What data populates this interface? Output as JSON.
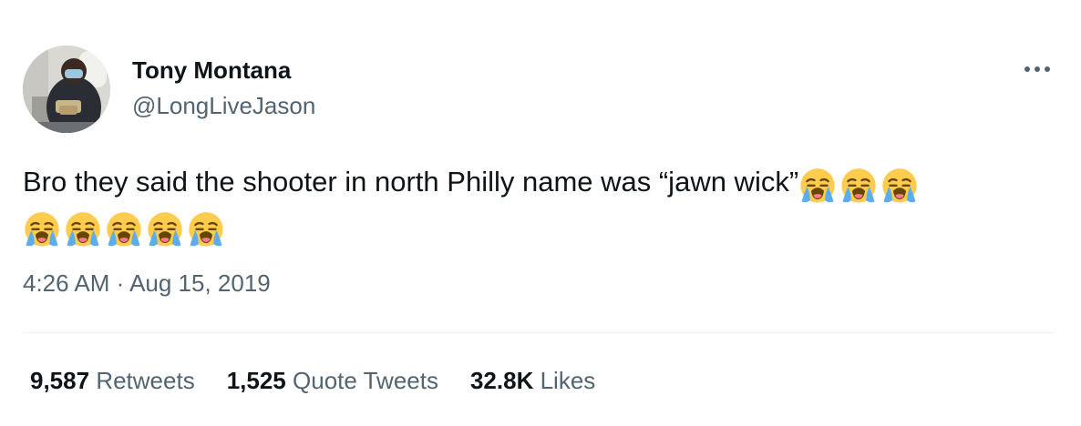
{
  "author": {
    "display_name": "Tony Montana",
    "handle": "@LongLiveJason"
  },
  "more_icon": "more-horizontal-icon",
  "tweet": {
    "text": "Bro they said the shooter in north Philly name was “jawn wick”",
    "emoji_name": "loudly-crying-face-icon",
    "emoji_count_line1": 3,
    "emoji_count_line2": 5
  },
  "timestamp": "4:26 AM · Aug 15, 2019",
  "stats": {
    "retweets_count": "9,587",
    "retweets_label": "Retweets",
    "quotes_count": "1,525",
    "quotes_label": "Quote Tweets",
    "likes_count": "32.8K",
    "likes_label": "Likes"
  },
  "colors": {
    "text": "#0f1419",
    "secondary": "#536471",
    "divider": "#eff3f4",
    "emoji_face": "#ffcc4d",
    "emoji_tears": "#5dadec"
  }
}
